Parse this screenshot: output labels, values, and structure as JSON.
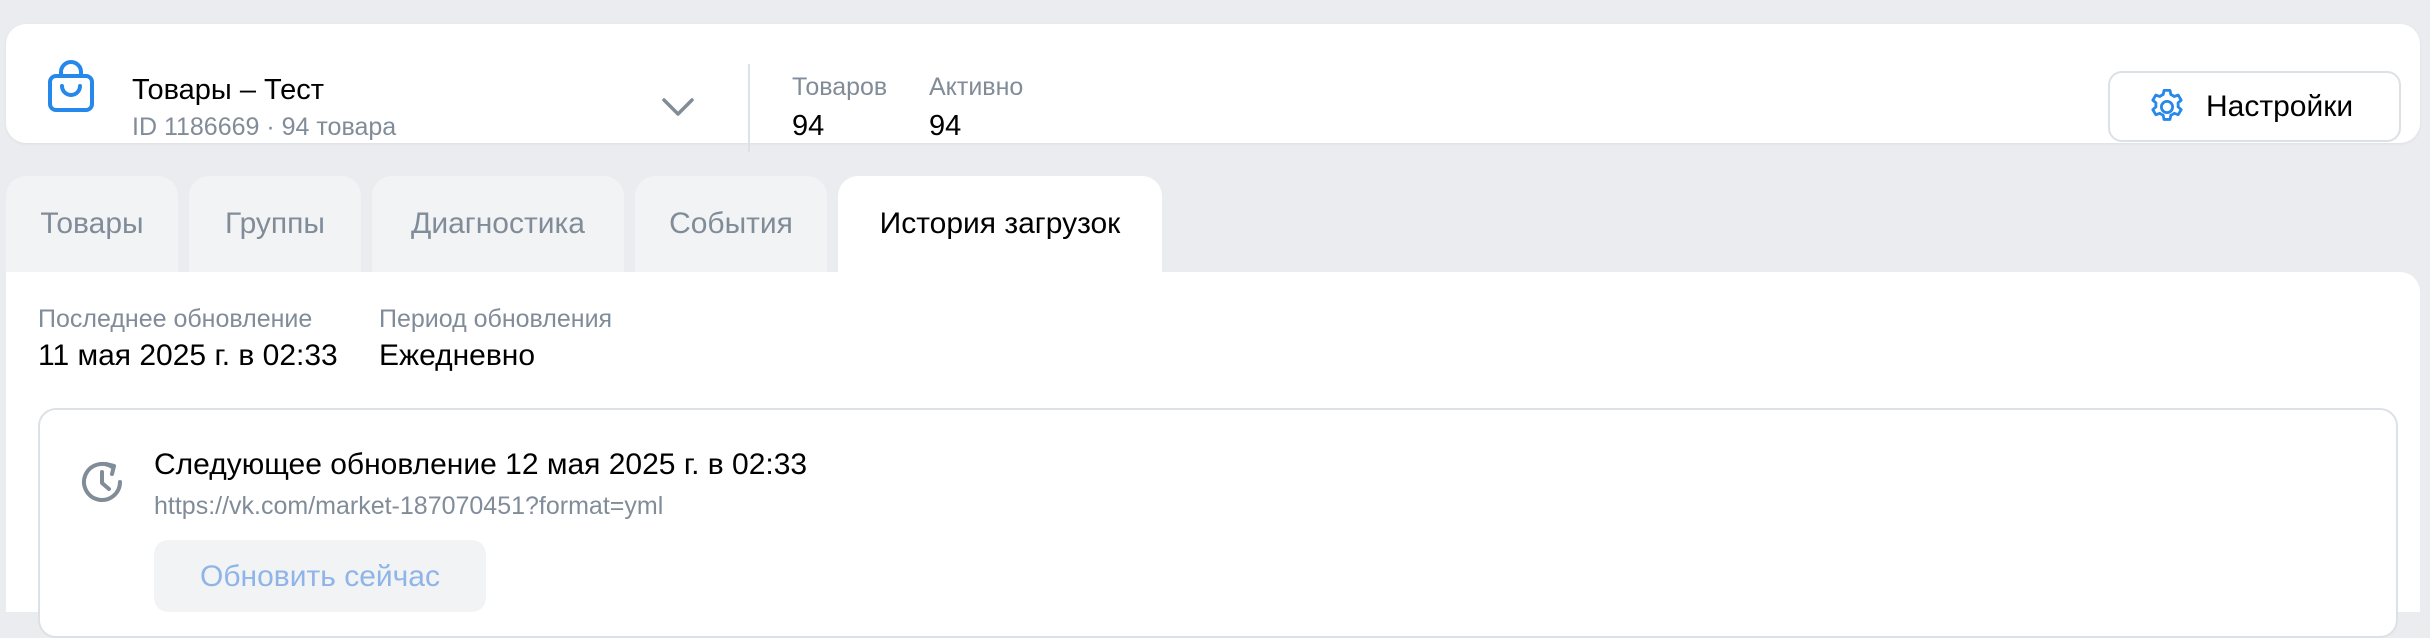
{
  "header": {
    "icon": "shopping-bag-icon",
    "catalog_name": "Товары – Тест",
    "catalog_meta": "ID 1186669 · 94 товара",
    "stats": [
      {
        "label": "Товаров",
        "value": "94"
      },
      {
        "label": "Активно",
        "value": "94"
      }
    ],
    "settings_label": "Настройки"
  },
  "tabs": [
    {
      "label": "Товары",
      "active": false
    },
    {
      "label": "Группы",
      "active": false
    },
    {
      "label": "Диагностика",
      "active": false
    },
    {
      "label": "События",
      "active": false
    },
    {
      "label": "История загрузок",
      "active": true
    }
  ],
  "panel": {
    "last_update_label": "Последнее обновление",
    "last_update_value": "11 мая 2025 г. в 02:33",
    "period_label": "Период обновления",
    "period_value": "Ежедневно",
    "next_update_text": "Следующее обновление 12 мая 2025 г. в 02:33",
    "feed_url": "https://vk.com/market-187070451?format=yml",
    "refresh_label": "Обновить сейчас"
  },
  "colors": {
    "accent": "#2688eb",
    "secondary_text": "#818c99",
    "background": "#ebecef",
    "disabled_button_text": "#8fb4e8"
  }
}
